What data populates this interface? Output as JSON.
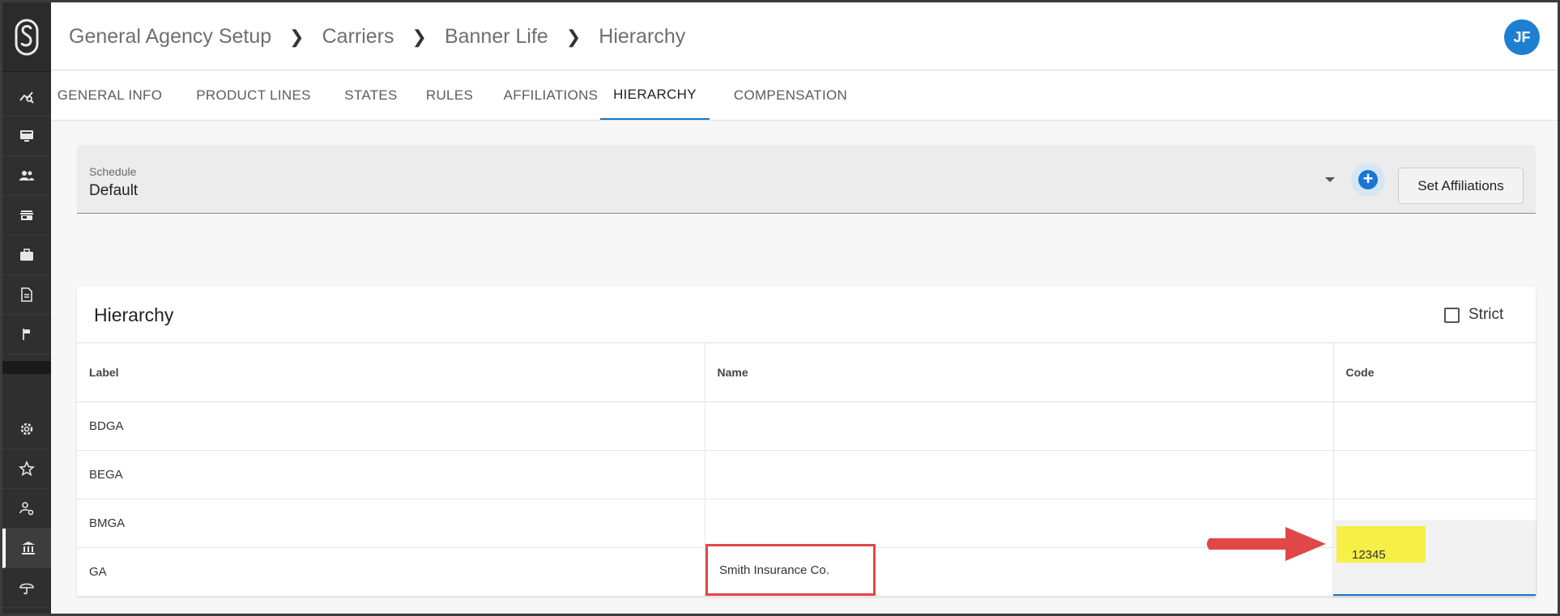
{
  "sidebar": {
    "logo": "logo-icon",
    "items": [
      {
        "icon": "analytics-icon"
      },
      {
        "icon": "monitor-icon"
      },
      {
        "icon": "people-icon"
      },
      {
        "icon": "storefront-icon"
      },
      {
        "icon": "briefcase-icon"
      },
      {
        "icon": "document-icon"
      },
      {
        "icon": "flag-icon"
      },
      {
        "icon": "gear-icon"
      },
      {
        "icon": "star-icon"
      },
      {
        "icon": "user-settings-icon"
      },
      {
        "icon": "bank-icon",
        "active": true
      },
      {
        "icon": "umbrella-icon"
      }
    ]
  },
  "header": {
    "breadcrumb": [
      "General Agency Setup",
      "Carriers",
      "Banner Life",
      "Hierarchy"
    ],
    "avatar_initials": "JF"
  },
  "tabs": [
    {
      "label": "GENERAL INFO"
    },
    {
      "label": "PRODUCT LINES"
    },
    {
      "label": "STATES"
    },
    {
      "label": "RULES"
    },
    {
      "label": "AFFILIATIONS"
    },
    {
      "label": "HIERARCHY",
      "active": true
    },
    {
      "label": "COMPENSATION"
    }
  ],
  "schedule": {
    "label": "Schedule",
    "value": "Default",
    "set_affiliations_label": "Set Affiliations"
  },
  "hierarchy": {
    "title": "Hierarchy",
    "strict_label": "Strict",
    "strict_checked": false,
    "columns": [
      "Label",
      "Name",
      "Code"
    ],
    "rows": [
      {
        "label": "BDGA",
        "name": "",
        "code": ""
      },
      {
        "label": "BEGA",
        "name": "",
        "code": ""
      },
      {
        "label": "BMGA",
        "name": "",
        "code": ""
      },
      {
        "label": "GA",
        "name": "Smith Insurance Co.",
        "code": "12345"
      }
    ]
  },
  "colors": {
    "accent": "#1976d2",
    "avatar": "#1e7fd1",
    "annotation_red": "#e04848",
    "highlight_yellow": "#f5ef46"
  }
}
